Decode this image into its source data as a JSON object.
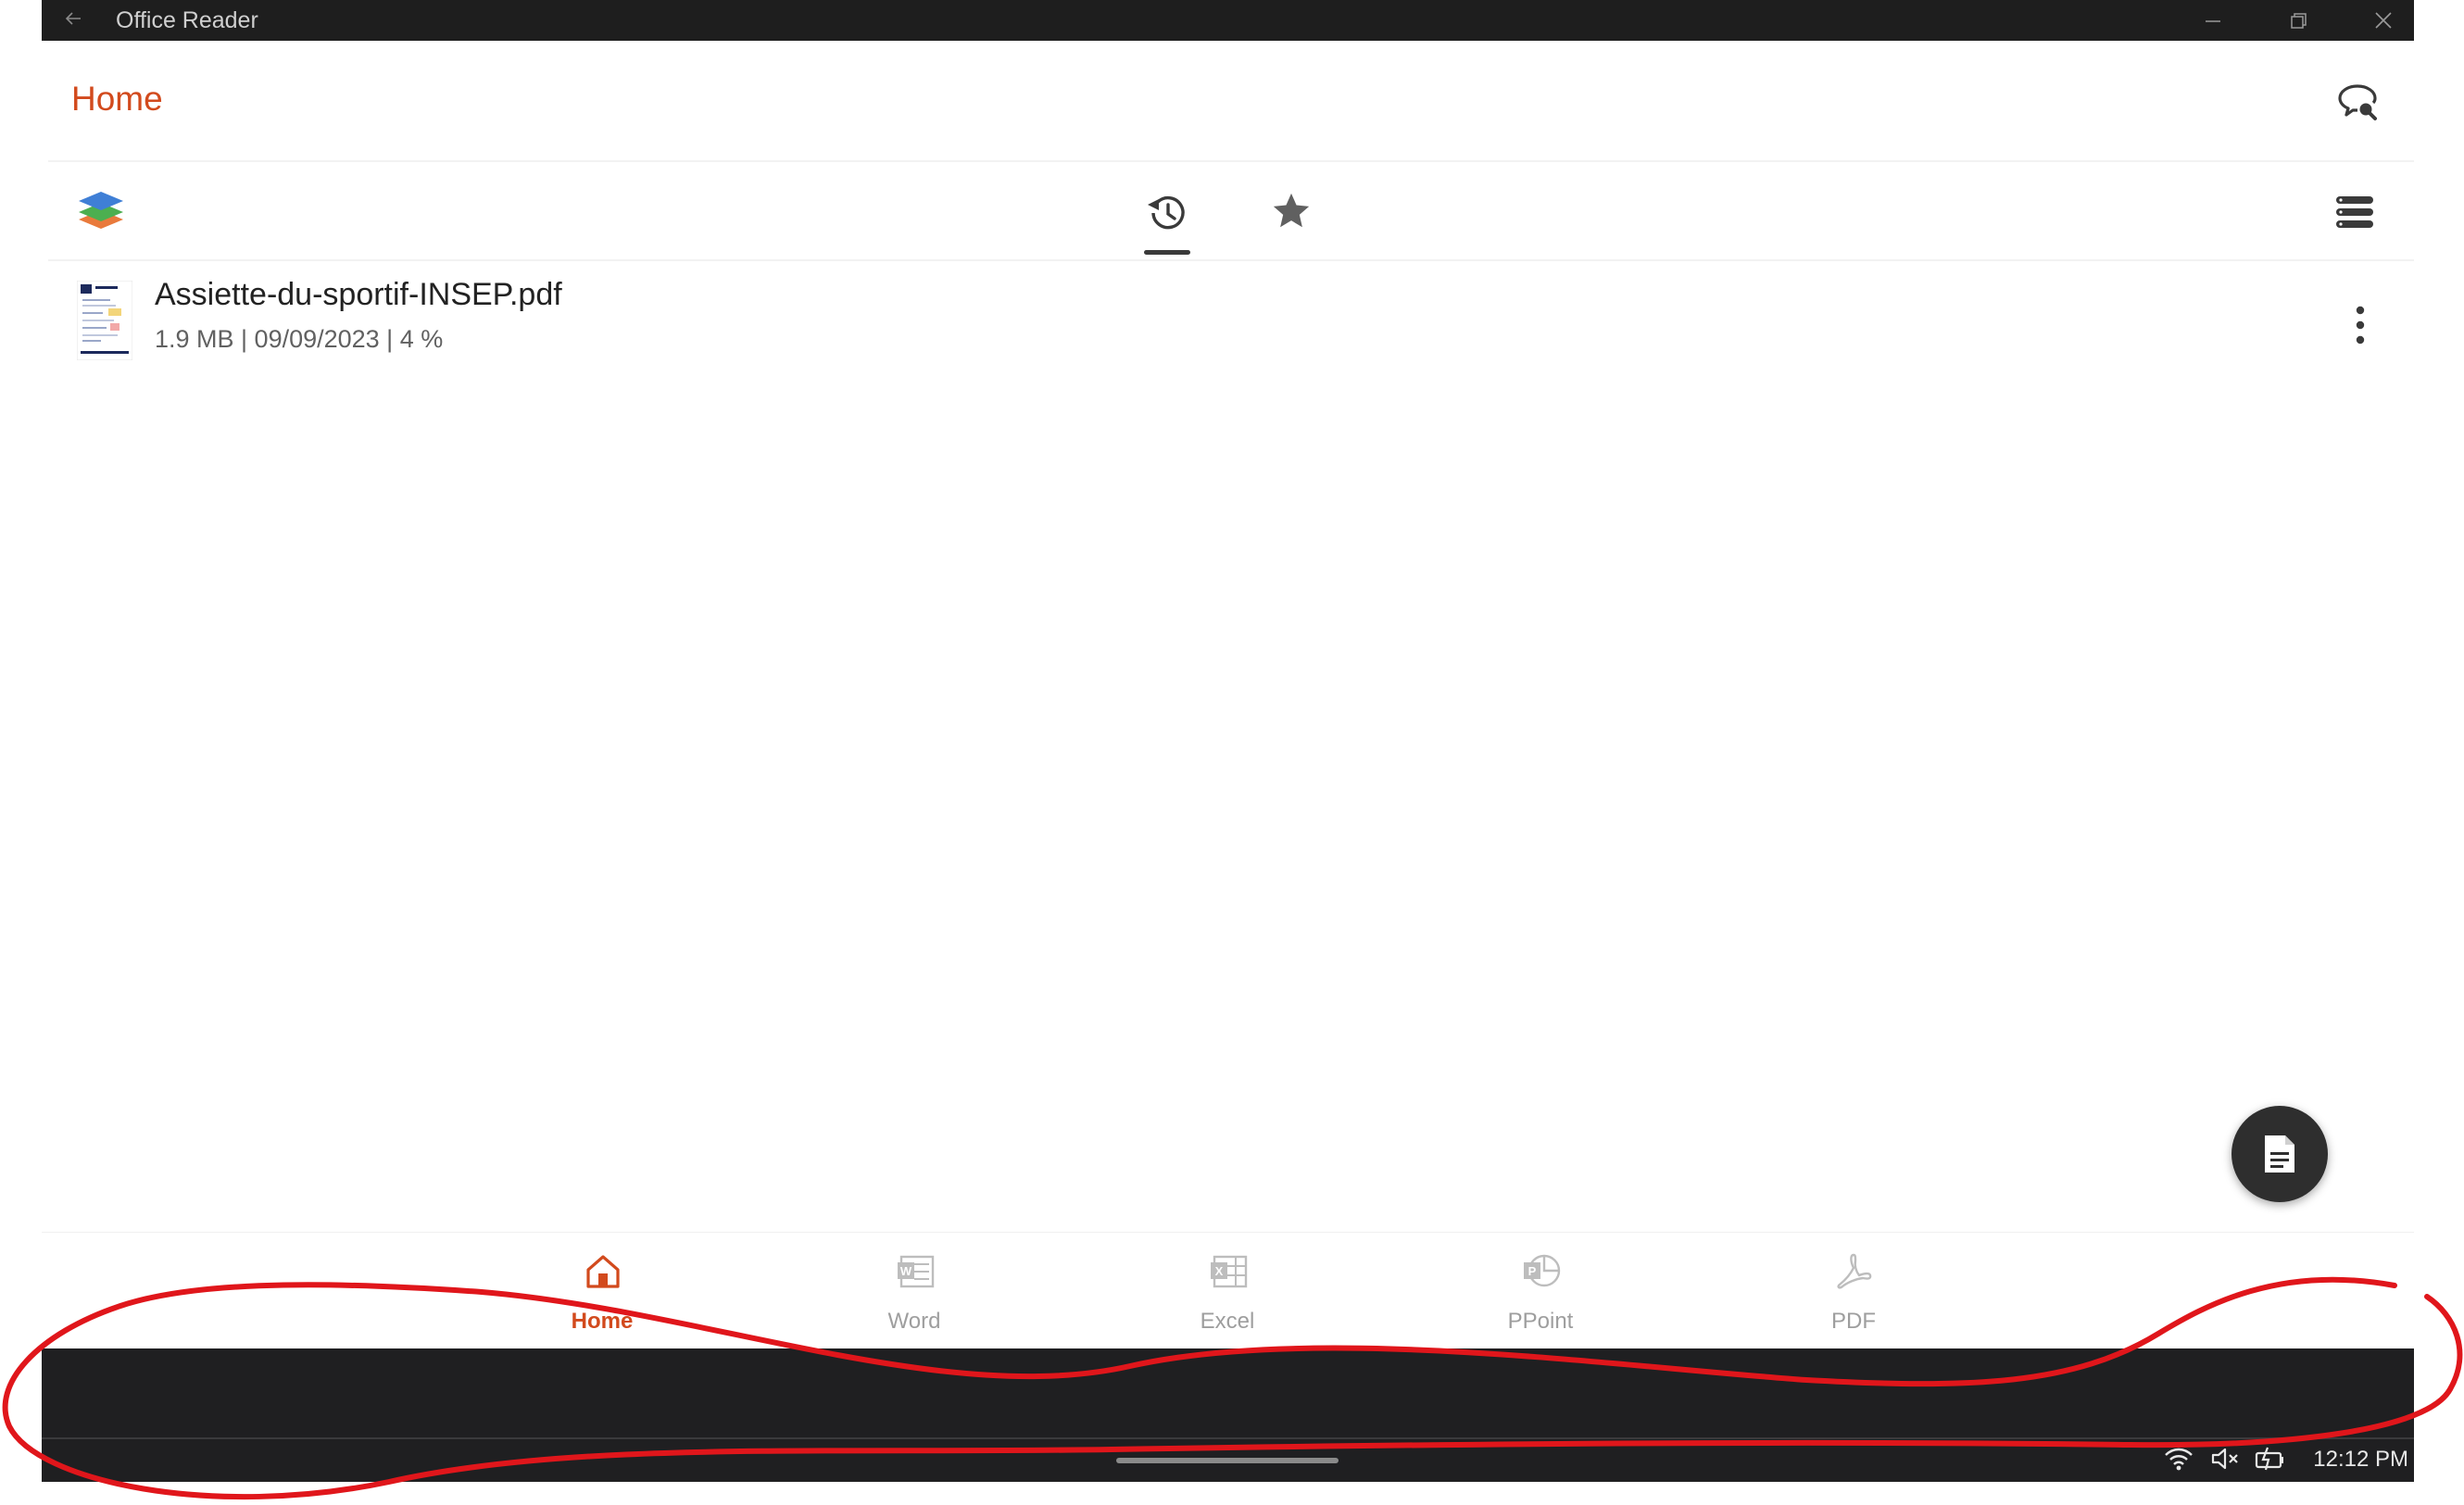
{
  "window": {
    "title": "Office Reader"
  },
  "header": {
    "title": "Home"
  },
  "toolbar": {
    "tabs": [
      {
        "name": "recent-icon"
      },
      {
        "name": "star-icon"
      }
    ]
  },
  "files": [
    {
      "name": "Assiette-du-sportif-INSEP.pdf",
      "meta": "1.9 MB | 09/09/2023 | 4 %"
    }
  ],
  "bottom_nav": [
    {
      "label": "Home",
      "icon": "home-icon",
      "active": true
    },
    {
      "label": "Word",
      "icon": "word-icon",
      "active": false
    },
    {
      "label": "Excel",
      "icon": "excel-icon",
      "active": false
    },
    {
      "label": "PPoint",
      "icon": "powerpoint-icon",
      "active": false
    },
    {
      "label": "PDF",
      "icon": "pdf-icon",
      "active": false
    }
  ],
  "system": {
    "time": "12:12 PM"
  },
  "colors": {
    "accent": "#d24a1d",
    "titlebar": "#1e1e1e",
    "annotation": "#e0161b"
  }
}
